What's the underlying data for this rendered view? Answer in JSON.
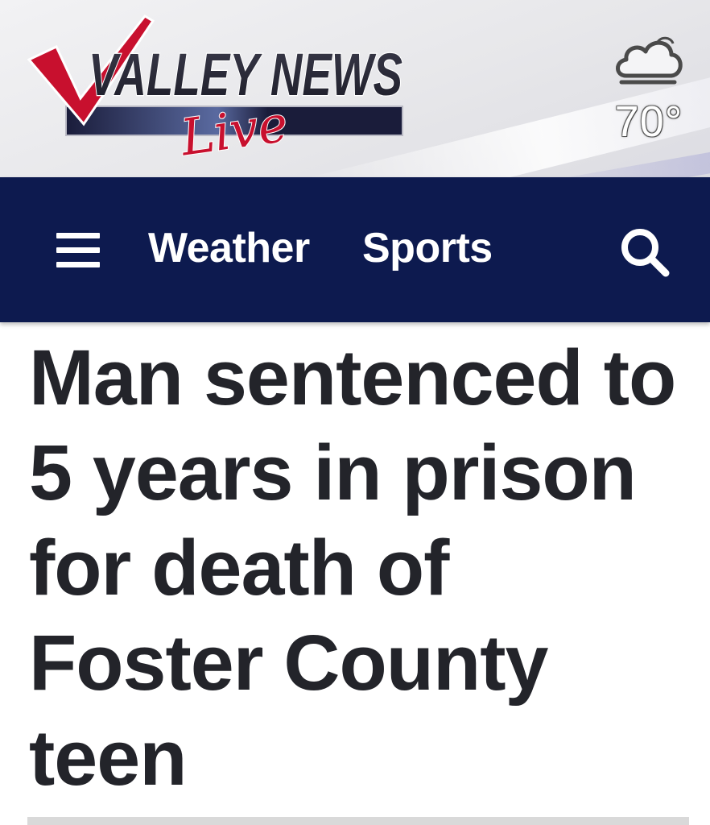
{
  "header": {
    "logo": {
      "line1": "VALLEY NEWS",
      "line2": "Live",
      "colors": {
        "red": "#c8102e",
        "dark": "#2b2b3a",
        "bar": "#1a1c3a"
      }
    },
    "weather": {
      "icon": "cloud-icon",
      "temperature": "70°"
    }
  },
  "nav": {
    "background": "#0d1a4f",
    "menu_icon": "hamburger-menu-icon",
    "links": [
      {
        "label": "Weather"
      },
      {
        "label": "Sports"
      }
    ],
    "search_icon": "search-icon"
  },
  "article": {
    "headline": "Man sentenced to 5 years in prison for death of Foster County teen"
  }
}
